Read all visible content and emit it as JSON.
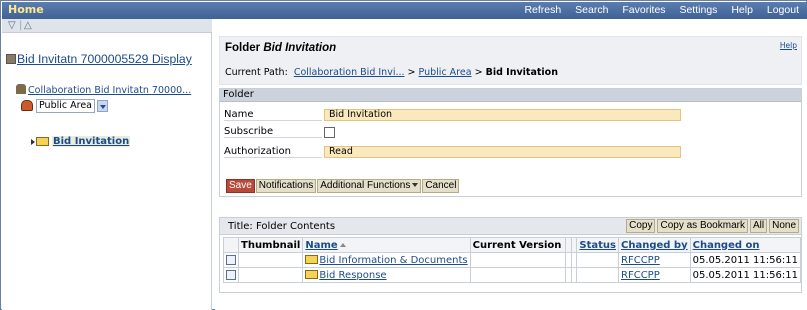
{
  "topbar": {
    "home": "Home",
    "nav": [
      "Refresh",
      "Search",
      "Favorites",
      "Settings",
      "Help",
      "Logout"
    ]
  },
  "left": {
    "title": "Bid Invitatn 7000005529 Display",
    "collab": "Collaboration Bid Invitatn 70000...",
    "area_select": "Public Area",
    "node": "Bid Invitation"
  },
  "header": {
    "title_prefix": "Folder",
    "title_name": "Bid Invitation",
    "help": "Help",
    "path_label": "Current Path:",
    "path_1": "Collaboration Bid Invi...",
    "path_sep": ">",
    "path_2": "Public Area",
    "path_3": "Bid Invitation"
  },
  "folder": {
    "group_title": "Folder",
    "name_label": "Name",
    "name_value": "Bid Invitation",
    "subscribe_label": "Subscribe",
    "auth_label": "Authorization",
    "auth_value": "Read",
    "buttons": {
      "save": "Save",
      "notifications": "Notifications",
      "additional": "Additional Functions",
      "cancel": "Cancel"
    }
  },
  "contents": {
    "title": "Title: Folder Contents",
    "toolbar": [
      "Copy",
      "Copy as Bookmark",
      "All",
      "None"
    ],
    "columns": [
      "Thumbnail",
      "Name",
      "Current Version",
      "Status",
      "Changed by",
      "Changed on"
    ],
    "rows": [
      {
        "name": "Bid Information & Documents",
        "changed_by": "RFCCPP",
        "changed_on": "05.05.2011 11:56:11"
      },
      {
        "name": "Bid Response",
        "changed_by": "RFCCPP",
        "changed_on": "05.05.2011 11:56:11"
      }
    ]
  },
  "colors": {
    "topbar": "#4a6ea3",
    "accent_link": "#1c4b8c",
    "field_bg": "#fbe9be",
    "save_btn": "#b84a3a"
  }
}
